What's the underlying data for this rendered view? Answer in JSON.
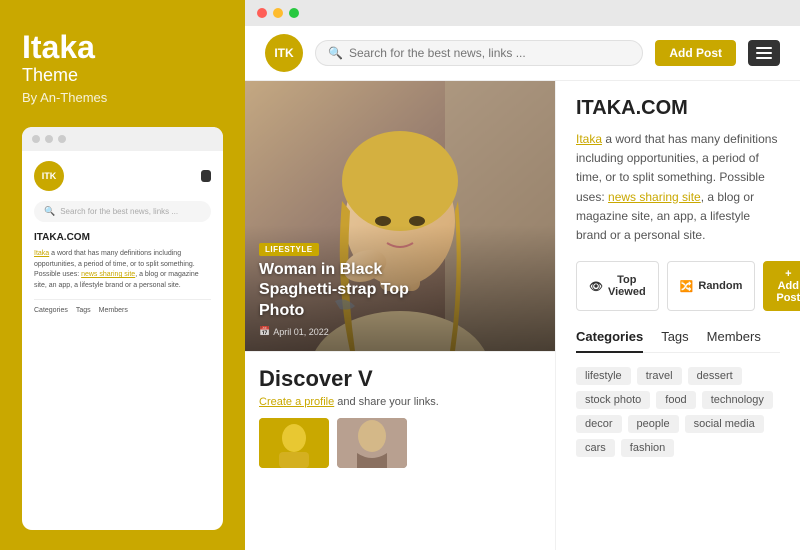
{
  "left_panel": {
    "brand": {
      "title": "Itaka",
      "subtitle": "Theme",
      "by": "By An-Themes"
    },
    "mini_browser": {
      "logo_text": "ITK",
      "search_placeholder": "Search for the best news, links ...",
      "site_title": "ITAKA.COM",
      "description_html": "Itaka a word that has many definitions including opportunities, a period of time, or to split something. Possible uses: news sharing site, a blog or magazine site, an app, a lifestyle brand or a personal site.",
      "nav_items": [
        "Categories",
        "Tags",
        "Members"
      ]
    }
  },
  "browser": {
    "logo_text": "ITK",
    "search_placeholder": "Search for the best news, links ...",
    "add_post_label": "Add Post",
    "hero": {
      "badge": "LIFESTYLE",
      "title_line1": "Woman in Black",
      "title_line2": "Spaghetti-strap Top",
      "title_line3": "Photo",
      "date": "April 01, 2022"
    },
    "sidebar": {
      "site_title": "ITAKA.COM",
      "description": "Itaka a word that has many definitions including opportunities, a period of time, or to split something. Possible uses: ",
      "link1": "Itaka",
      "link2": "news sharing site",
      "description_end": ", a blog or magazine site, an app, a lifestyle brand or a personal site.",
      "actions": {
        "top_viewed": "Top Viewed",
        "random": "Random",
        "add_post": "+ Add Post"
      },
      "tabs": [
        "Categories",
        "Tags",
        "Members"
      ],
      "active_tab": "Categories",
      "tags": [
        "lifestyle",
        "travel",
        "dessert",
        "stock photo",
        "food",
        "technology",
        "decor",
        "people",
        "social media",
        "cars",
        "fashion"
      ]
    },
    "discover": {
      "title": "Discover V",
      "subtitle": "Create a profile",
      "subtitle_end": " and share your links."
    }
  }
}
